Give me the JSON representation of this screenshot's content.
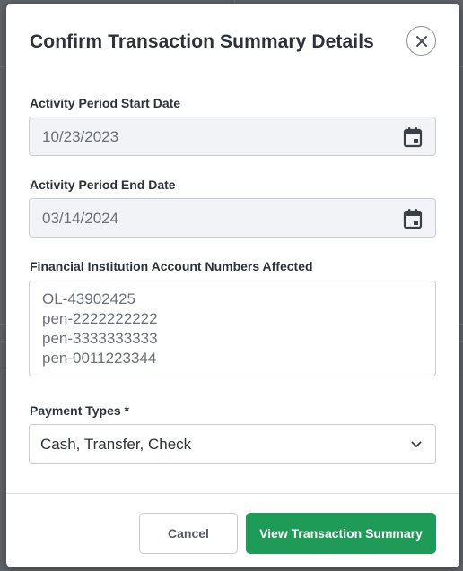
{
  "colors": {
    "overlay": "#5f6266",
    "primary_button": "#1e9c57",
    "input_disabled_bg": "#f1f3f7",
    "border": "#c9ced6"
  },
  "modal": {
    "title": "Confirm Transaction Summary Details",
    "close_icon": "close-icon",
    "fields": {
      "start_date": {
        "label": "Activity Period Start Date",
        "value": "10/23/2023",
        "icon": "calendar-icon"
      },
      "end_date": {
        "label": "Activity Period End Date",
        "value": "03/14/2024",
        "icon": "calendar-icon"
      },
      "accounts": {
        "label": "Financial Institution Account Numbers Affected",
        "lines": [
          "OL-43902425",
          "pen-2222222222",
          "pen-3333333333",
          "pen-0011223344"
        ]
      },
      "payment_types": {
        "label": "Payment Types *",
        "selected": "Cash, Transfer, Check",
        "icon": "chevron-down-icon"
      }
    },
    "footer": {
      "cancel_label": "Cancel",
      "submit_label": "View Transaction Summary"
    }
  }
}
